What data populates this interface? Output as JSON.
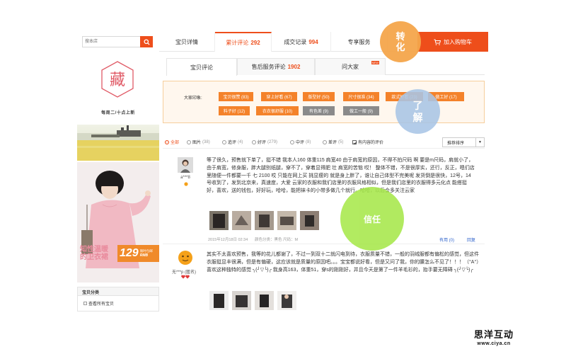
{
  "search": {
    "placeholder": "搜本店"
  },
  "shop": {
    "logo_char": "藏",
    "slogan": "每周二/十点上新",
    "promo_title": "知性温暖",
    "promo_subtitle": "的卫衣裙",
    "promo_price": "129",
    "promo_price_note": "限时包邮",
    "promo_currency": "RMB"
  },
  "categories": {
    "title": "宝贝分类",
    "item": "查看所有宝贝"
  },
  "tabs": {
    "detail": "宝贝详情",
    "reviews_label": "累计评论",
    "reviews_count": "292",
    "sales_label": "成交记录",
    "sales_count": "994",
    "service": "专享服务",
    "cart": "加入购物车"
  },
  "subtabs": {
    "reviews": "宝贝评论",
    "aftersale_label": "售后服务评论",
    "aftersale_count": "1902",
    "ask": "问大家",
    "ask_badge": "NEW"
  },
  "impression": {
    "label": "大家印象:",
    "tags_row1": [
      "宝贝很赞 (83)",
      "穿上好看 (67)",
      "版型好 (50)",
      "尺寸很准 (34)",
      "款式好看 (23)",
      "做工好 (17)"
    ],
    "tags_row2": [
      "料子好 (12)",
      "衣衣很舒服 (10)",
      "有色差 (9)",
      "做工一般 (9)"
    ]
  },
  "filters": {
    "all": "全部",
    "image": "图片",
    "image_count": "(38)",
    "append": "追评",
    "append_count": "(4)",
    "good": "好评",
    "good_count": "(279)",
    "mid": "中评",
    "mid_count": "(8)",
    "bad": "差评",
    "bad_count": "(5)",
    "content_only": "有内容的评价",
    "sort": "推荐排序"
  },
  "reviews": [
    {
      "user": "a***8",
      "text": "等了很久，预售就下单了，挺不错 我本人160 体重115 肩宽40 由于肩宽的原因，不得不拍尺码 啊 要是m尺码，肩就小了，由于肩宽，修身服，胖大腿别纸腿，穿不了，穿着显得肥 壮 肩宽的苦恼 哎！ 整体不错，不是很厚实，还行，反正，嗯们店里随便一件都要一千 七 2100 哎 只能在网上买 挑显瘦的 就是身上胖了，谁让自己体型不完美呢 发货倒是很快，12号，14号收到了，发到北京来，真速度，大爱 云家的衣服和我们店里的衣服风格相似，但是我们店里的衣服得多元化点 能搭挺好，喜欢，送的钱包，好好玩，哈哈，能把袜卡的小带多做几个就行。哈哈，以后会多关注云家",
      "date": "2015年12月18日 02:34",
      "spec": "颜色分类：黑色  尺码：M",
      "useful": "有用 (0)",
      "reply": "回复"
    },
    {
      "user": "无***p (匿名)",
      "text": "其实不太喜欢预售，我等的花儿都谢了，不过一到双十二就闪电到待，衣服质量不错，一般的羽绒服都有偏松的感觉，但这件衣服挺显丰很满，但是有偏硬，这应该就是质量的原因吧。。。宝宝都说好看，但是又问了我，你的腰怎么不见了！！！（°A°）喜欢这种独特的感觉 ╮(╯▽╰)╭ 我身高163，体重51，穿s的刚刚好，并且今天是第了一件羊毛衫的，抬手要无障碍 ╮(╯▽╰)╭"
    }
  ],
  "bubbles": {
    "transform": "转化",
    "understand": "了解",
    "trust": "信任"
  },
  "watermark": {
    "title": "思洋互动",
    "url": "www.ciya.cn"
  },
  "colors": {
    "accent": "#ee4e1b",
    "tag_orange": "#f4822a",
    "tag_gray": "#8a8a8a",
    "bubble_orange": "#f5a64b",
    "bubble_blue": "#a9c6e6",
    "bubble_green": "#a7e84b"
  }
}
